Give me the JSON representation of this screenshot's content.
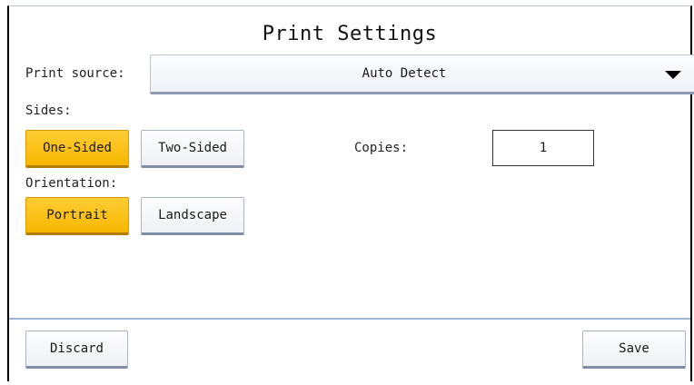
{
  "header": {
    "title": "Print Settings"
  },
  "print_source": {
    "label": "Print source:",
    "value": "Auto Detect"
  },
  "sides": {
    "label": "Sides:",
    "options": [
      "One-Sided",
      "Two-Sided"
    ],
    "selected": "One-Sided"
  },
  "copies": {
    "label": "Copies:",
    "value": "1"
  },
  "orientation": {
    "label": "Orientation:",
    "options": [
      "Portrait",
      "Landscape"
    ],
    "selected": "Portrait"
  },
  "footer": {
    "discard_label": "Discard",
    "save_label": "Save"
  },
  "colors": {
    "selected": "#f6b800",
    "divider": "#9db4d6"
  }
}
